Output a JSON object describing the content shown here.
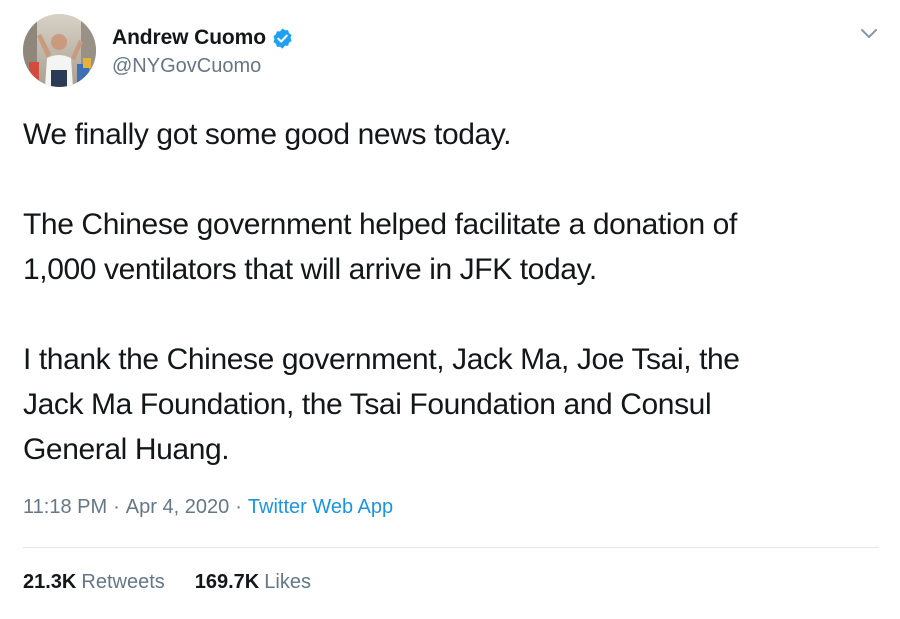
{
  "author": {
    "display_name": "Andrew Cuomo",
    "handle": "@NYGovCuomo",
    "verified": true,
    "verified_icon": "verified-badge-icon",
    "avatar": "profile-photo"
  },
  "tweet": {
    "paragraphs": [
      {
        "lines": [
          "We finally got some good news today."
        ]
      },
      {
        "lines": [
          "The Chinese government helped facilitate a donation of",
          "1,000 ventilators that will arrive in JFK today."
        ]
      },
      {
        "lines": [
          "I thank the Chinese government, Jack Ma, Joe Tsai, the",
          "Jack Ma Foundation, the Tsai Foundation and Consul",
          "General Huang."
        ]
      }
    ]
  },
  "meta": {
    "time": "11:18 PM",
    "separator": "·",
    "date": "Apr 4, 2020",
    "source": "Twitter Web App"
  },
  "stats": {
    "retweets_count": "21.3K",
    "retweets_label": "Retweets",
    "likes_count": "169.7K",
    "likes_label": "Likes"
  },
  "colors": {
    "text_primary": "#14171a",
    "text_secondary": "#657786",
    "link": "#1b95e0",
    "verified": "#1da1f2",
    "divider": "#e1e8ed"
  },
  "icons": {
    "more_menu": "chevron-down-icon"
  }
}
